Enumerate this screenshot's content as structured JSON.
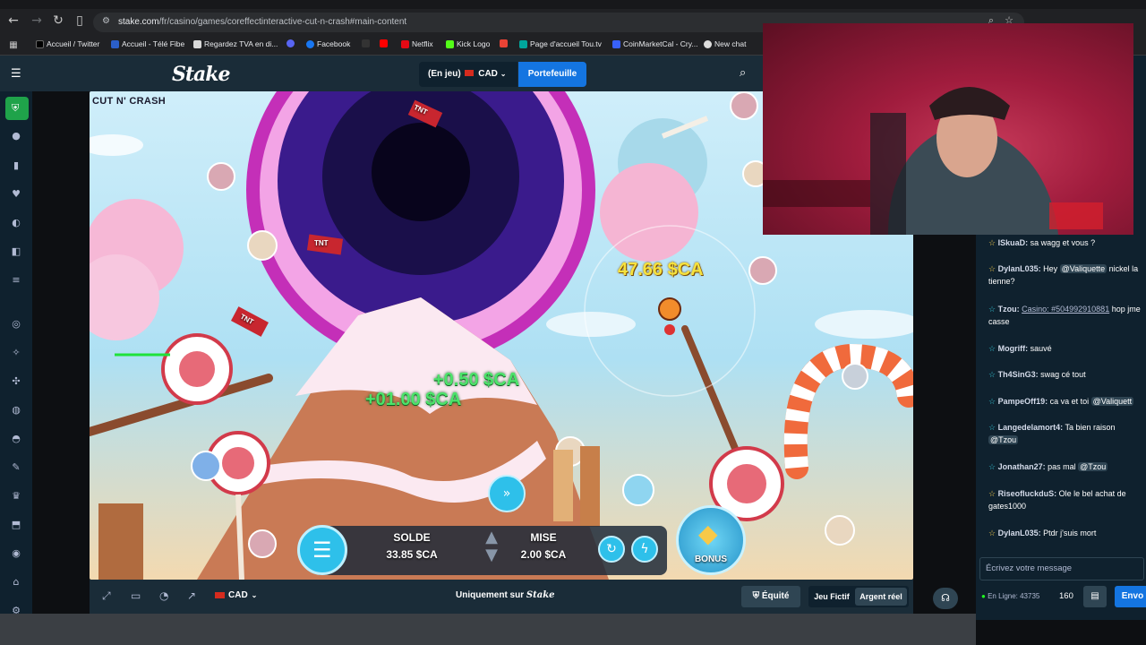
{
  "browser": {
    "url_host": "stake.com",
    "url_path": "/fr/casino/games/coreffectinteractive-cut-n-crash#main-content",
    "bookmarks": [
      "Accueil / Twitter",
      "Accueil - Télé Fibe",
      "Regardez TVA en di...",
      "Facebook",
      "Netflix",
      "Kick Logo",
      "Page d'accueil Tou.tv",
      "CoinMarketCal - Cry...",
      "New chat"
    ]
  },
  "header": {
    "logo": "Stake",
    "balance": "(En jeu)",
    "currency": "CAD",
    "wallet_label": "Portefeuille"
  },
  "game": {
    "title": "CUT N' CRASH",
    "multiplier_text": "47.66 $CA",
    "gain1": "+0.50 $CA",
    "gain2": "+01.00 $CA",
    "tnt1": "TNT",
    "tnt2": "TNT",
    "tnt3": "TNT",
    "solde_label": "SOLDE",
    "solde_value": "33.85 $CA",
    "mise_label": "MISE",
    "mise_value": "2.00 $CA",
    "bonus_label": "BONUS"
  },
  "bottom_bar": {
    "currency": "CAD",
    "exclusive": "Uniquement sur",
    "exclusive_brand": "Stake",
    "equity": "Équité",
    "fun_mode": "Jeu Fictif",
    "real_mode": "Argent réel"
  },
  "chat": {
    "messages": [
      {
        "user": "ISkuaD:",
        "text": " sa wagg et vous ?"
      },
      {
        "user": "DylanL035:",
        "text": " Hey ",
        "mention": "@Valiquette",
        "tail": " nickel la tienne?"
      },
      {
        "user": "Tzou:",
        "text": " ",
        "link": "Casino: #504992910881",
        "tail": " hop jme casse"
      },
      {
        "user": "Mogriff:",
        "text": " sauvé"
      },
      {
        "user": "Th4SinG3:",
        "text": " swag cé tout"
      },
      {
        "user": "PampeOff19:",
        "text": " ca va et toi ",
        "mention": "@Valiquett"
      },
      {
        "user": "Langedelamort4:",
        "text": " Ta bien raison ",
        "mention": "@Tzou"
      },
      {
        "user": "Jonathan27:",
        "text": " pas mal ",
        "mention": "@Tzou"
      },
      {
        "user": "RiseofluckduS:",
        "text": " Ole le bel achat de gates1000"
      },
      {
        "user": "DylanL035:",
        "text": " Ptdr j'suis mort"
      }
    ],
    "input_placeholder": "Écrivez votre message",
    "online_label": "En Ligne: 43735",
    "count": "160",
    "send_label": "Envo"
  },
  "colors": {
    "stake_blue": "#1475e1",
    "stake_dark": "#0f212e",
    "stake_panel": "#1a2c38",
    "accent_green": "#1fff20"
  }
}
